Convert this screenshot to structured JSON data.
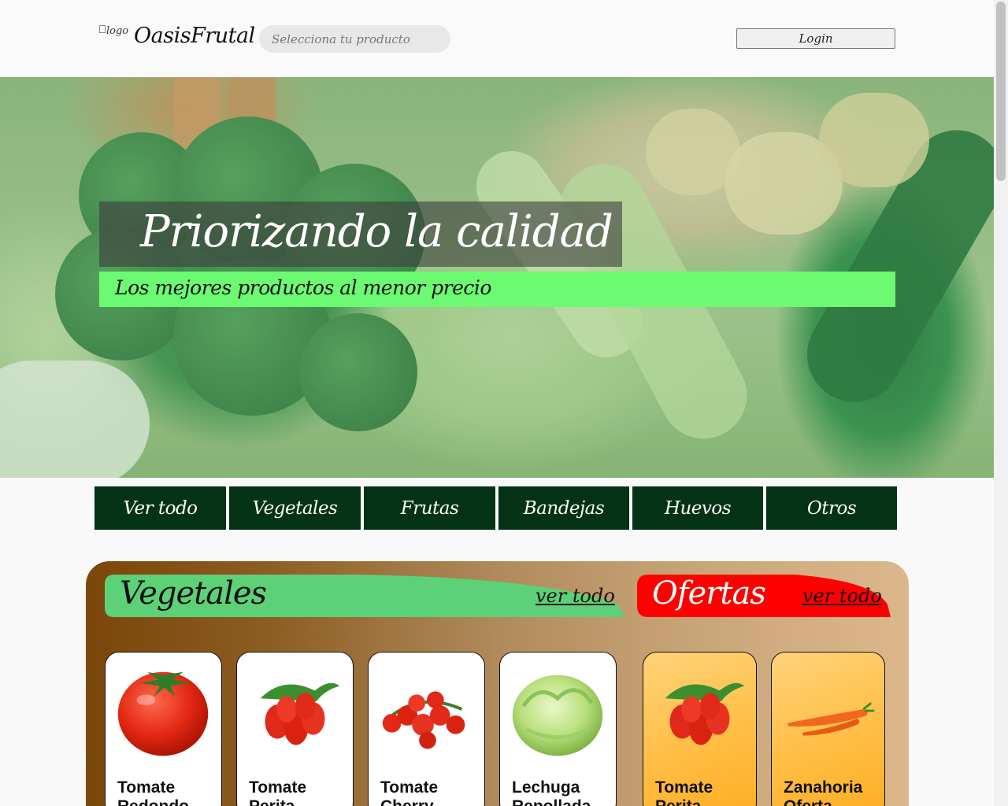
{
  "header": {
    "logo_alt": "logo",
    "brand": "OasisFrutal",
    "search_placeholder": "Selecciona tu producto",
    "login_label": "Login"
  },
  "hero": {
    "title": "Priorizando la calidad",
    "subtitle": "Los mejores productos al menor precio"
  },
  "categories": [
    "Ver todo",
    "Vegetales",
    "Frutas",
    "Bandejas",
    "Huevos",
    "Otros"
  ],
  "sections": {
    "vegetales": {
      "title": "Vegetales",
      "link": "ver todo"
    },
    "ofertas": {
      "title": "Ofertas",
      "link": "ver todo"
    }
  },
  "products": [
    {
      "name": "Tomate Redondo",
      "icon": "tomato-icon"
    },
    {
      "name": "Tomate Perita",
      "icon": "plum-tomato-icon"
    },
    {
      "name": "Tomate Cherry",
      "icon": "cherry-tomato-icon"
    },
    {
      "name": "Lechuga Repollada",
      "icon": "lettuce-icon"
    }
  ],
  "offers": [
    {
      "name": "Tomate Perita",
      "icon": "plum-tomato-icon"
    },
    {
      "name": "Zanahoria Oferta",
      "icon": "carrot-icon"
    }
  ],
  "colors": {
    "nav_bg": "#033314",
    "subtitle_bg": "#6bfa71",
    "veg_header": "#5dd177",
    "offer_header": "#ff0000"
  }
}
